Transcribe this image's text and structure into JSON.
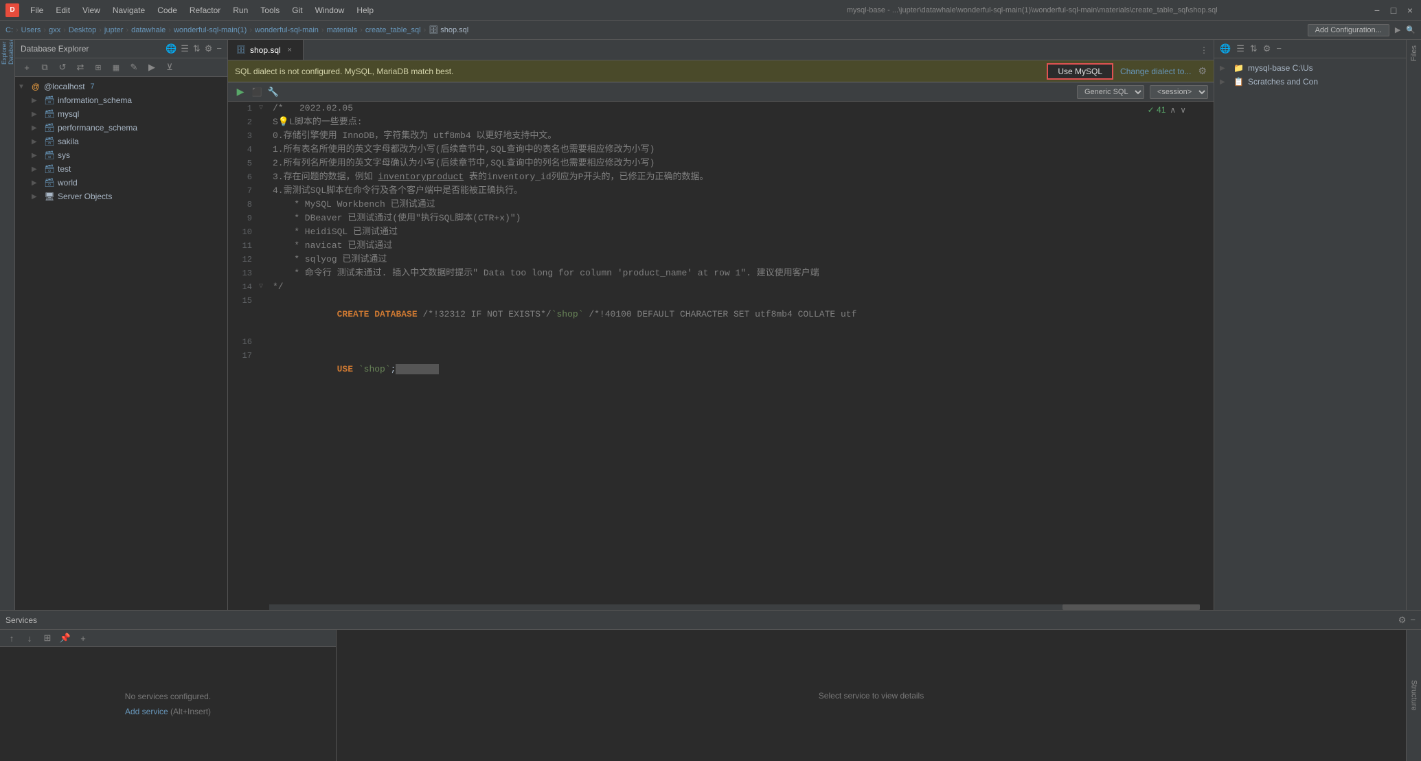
{
  "titleBar": {
    "logo": "D",
    "menus": [
      "File",
      "Edit",
      "View",
      "Navigate",
      "Code",
      "Refactor",
      "Run",
      "Tools",
      "Git",
      "Window",
      "Help"
    ],
    "title": "mysql-base - ...\\jupter\\datawhale\\wonderful-sql-main(1)\\wonderful-sql-main\\materials\\create_table_sql\\shop.sql",
    "windowControls": [
      "−",
      "□",
      "×"
    ]
  },
  "breadcrumb": {
    "items": [
      "C:",
      "Users",
      "gxx",
      "Desktop",
      "jupter",
      "datawhale",
      "wonderful-sql-main(1)",
      "wonderful-sql-main",
      "materials",
      "create_table_sql"
    ],
    "current": "shop.sql",
    "addConfigBtn": "Add Configuration..."
  },
  "dbPanel": {
    "title": "Database Explorer",
    "host": "@localhost",
    "count": "7",
    "databases": [
      {
        "name": "information_schema",
        "type": "schema"
      },
      {
        "name": "mysql",
        "type": "schema"
      },
      {
        "name": "performance_schema",
        "type": "schema"
      },
      {
        "name": "sakila",
        "type": "schema"
      },
      {
        "name": "sys",
        "type": "schema"
      },
      {
        "name": "test",
        "type": "schema"
      },
      {
        "name": "world",
        "type": "schema"
      },
      {
        "name": "Server Objects",
        "type": "server"
      }
    ]
  },
  "tabs": {
    "active": "shop.sql",
    "items": [
      "shop.sql"
    ]
  },
  "dialectWarning": {
    "message": "SQL dialect is not configured. MySQL, MariaDB match best.",
    "useMysqlBtn": "Use MySQL",
    "changeDialectBtn": "Change dialect to...",
    "gearIcon": "⚙"
  },
  "editor": {
    "dialectSelector": "Generic SQL ▾",
    "sessionSelector": "<session> ▾",
    "lineCount": "✓ 41",
    "lines": [
      {
        "num": "1",
        "fold": "▽",
        "content": "/*   2022.02.05",
        "type": "comment"
      },
      {
        "num": "2",
        "fold": "",
        "content": "S💡L脚本的一些要点:",
        "type": "comment"
      },
      {
        "num": "3",
        "fold": "",
        "content": "0.存储引擎使用 InnoDB，字符集改为 utf8mb4 以更好地支持中文。",
        "type": "comment"
      },
      {
        "num": "4",
        "fold": "",
        "content": "1.所有表名所使用的英文字母都改为小写(后续章节中,SQL查询中的表名也需要相应修改为小写)",
        "type": "comment"
      },
      {
        "num": "5",
        "fold": "",
        "content": "2.所有列名所使用的英文字母确认为小写(后续章节中,SQL查询中的列名也需要相应修改为小写)",
        "type": "comment"
      },
      {
        "num": "6",
        "fold": "",
        "content": "3.存在问题的数据，例如 inventoryproduct 表的inventory_id列应为P开头的，已修正为正确的数据。",
        "type": "comment"
      },
      {
        "num": "7",
        "fold": "",
        "content": "4.需测试SQL脚本在命令行及各个客户端中是否能被正确执行。",
        "type": "comment"
      },
      {
        "num": "8",
        "fold": "",
        "content": "    * MySQL Workbench 已测试通过",
        "type": "comment"
      },
      {
        "num": "9",
        "fold": "",
        "content": "    * DBeaver 已测试通过(使用\"执行SQL脚本(CTR+x)\")",
        "type": "comment"
      },
      {
        "num": "10",
        "fold": "",
        "content": "    * HeidiSQL 已测试通过",
        "type": "comment"
      },
      {
        "num": "11",
        "fold": "",
        "content": "    * navicat 已测试通过",
        "type": "comment"
      },
      {
        "num": "12",
        "fold": "",
        "content": "    * sqlyog 已测试通过",
        "type": "comment"
      },
      {
        "num": "13",
        "fold": "",
        "content": "    * 命令行 测试未通过. 插入中文数据时提示\" Data too long for column 'product_name' at row 1\". 建议使用客户端",
        "type": "comment"
      },
      {
        "num": "14",
        "fold": "▽",
        "content": "*/",
        "type": "comment"
      },
      {
        "num": "15",
        "fold": "",
        "content": "CREATE DATABASE /*!32312 IF NOT EXISTS*/`shop` /*!40100 DEFAULT CHARACTER SET utf8mb4 COLLATE utf",
        "type": "code"
      },
      {
        "num": "16",
        "fold": "",
        "content": "",
        "type": "empty"
      },
      {
        "num": "17",
        "fold": "",
        "content": "USE `shop`;",
        "type": "code"
      }
    ]
  },
  "rightPanel": {
    "items": [
      {
        "label": "mysql-base C:\\Us",
        "icon": "folder"
      },
      {
        "label": "Scratches and Con",
        "icon": "folder"
      }
    ]
  },
  "services": {
    "title": "Services",
    "noServices": "No services configured.",
    "addService": "Add service",
    "addServiceHint": "(Alt+Insert)",
    "selectService": "Select service to view details"
  },
  "structure": {
    "label": "Structure"
  }
}
